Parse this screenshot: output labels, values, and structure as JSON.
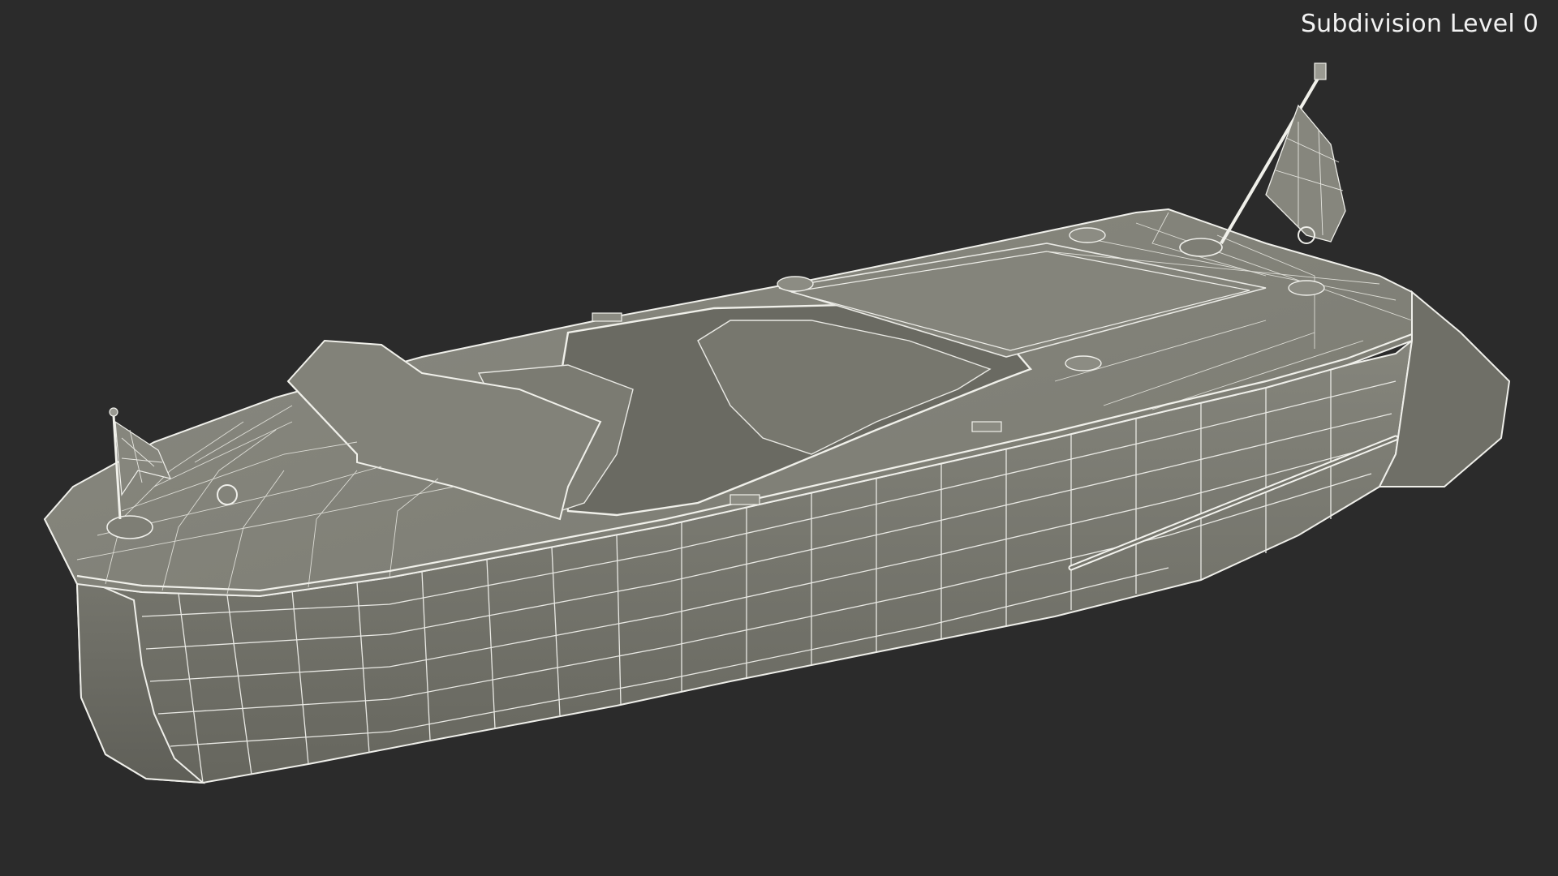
{
  "viewport": {
    "overlay_label": "Subdivision Level 0",
    "background_color": "#2b2b2b",
    "model_color": "#7b7b72",
    "wire_color": "#e9e9e4"
  },
  "model": {
    "subject": "runabout-boat-wireframe"
  }
}
